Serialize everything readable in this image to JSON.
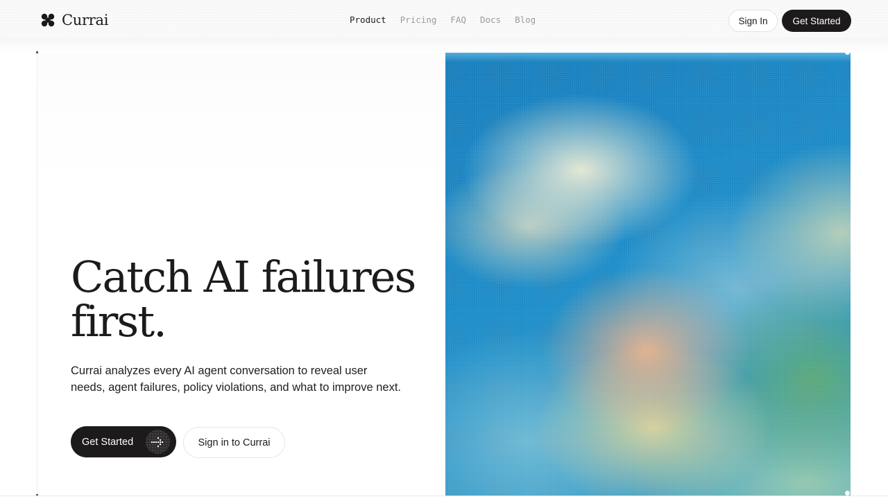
{
  "header": {
    "logo_text": "Currai",
    "logo_icon": "clover-icon",
    "nav": [
      {
        "label": "Product",
        "active": true
      },
      {
        "label": "Pricing",
        "active": false
      },
      {
        "label": "FAQ",
        "active": false
      },
      {
        "label": "Docs",
        "active": false
      },
      {
        "label": "Blog",
        "active": false
      }
    ],
    "sign_in_label": "Sign In",
    "get_started_label": "Get Started"
  },
  "hero": {
    "headline": "Catch AI failures first.",
    "subtext": "Currai analyzes every AI agent conversation to reveal user needs, agent failures, policy violations, and what to improve next.",
    "primary_cta_label": "Get Started",
    "primary_cta_icon": "arrow-right-icon",
    "secondary_cta_label": "Sign in to Currai"
  },
  "colors": {
    "ink": "#1c1a1b",
    "muted_nav": "#9a9a9a",
    "visual_blue": "#1e8ac4",
    "visual_cream": "#eeecd4",
    "visual_peach": "#ebb28c",
    "visual_green": "#5faa78"
  }
}
